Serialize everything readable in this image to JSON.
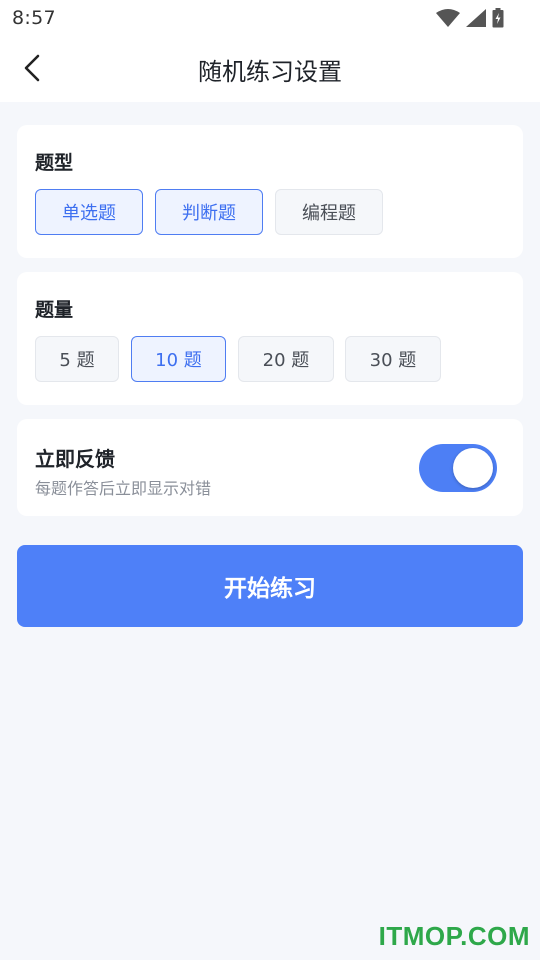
{
  "status_bar": {
    "time": "8:57",
    "icons": [
      "wifi-icon",
      "signal-icon",
      "battery-icon"
    ]
  },
  "header": {
    "title": "随机练习设置",
    "back_icon": "chevron-left-icon"
  },
  "question_type": {
    "title": "题型",
    "options": [
      {
        "label": "单选题",
        "selected": true
      },
      {
        "label": "判断题",
        "selected": true
      },
      {
        "label": "编程题",
        "selected": false
      }
    ]
  },
  "question_count": {
    "title": "题量",
    "options": [
      {
        "label": "5 题",
        "selected": false
      },
      {
        "label": "10 题",
        "selected": true
      },
      {
        "label": "20 题",
        "selected": false
      },
      {
        "label": "30 题",
        "selected": false
      }
    ]
  },
  "feedback": {
    "title": "立即反馈",
    "subtitle": "每题作答后立即显示对错",
    "enabled": true
  },
  "start_button": {
    "label": "开始练习"
  },
  "watermark": "ITMOP.COM",
  "colors": {
    "accent": "#4E80F8",
    "selected_bg": "#EEF3FF",
    "selected_text": "#3D6FF0",
    "page_bg": "#F5F7FB",
    "watermark": "#2EA84A"
  }
}
